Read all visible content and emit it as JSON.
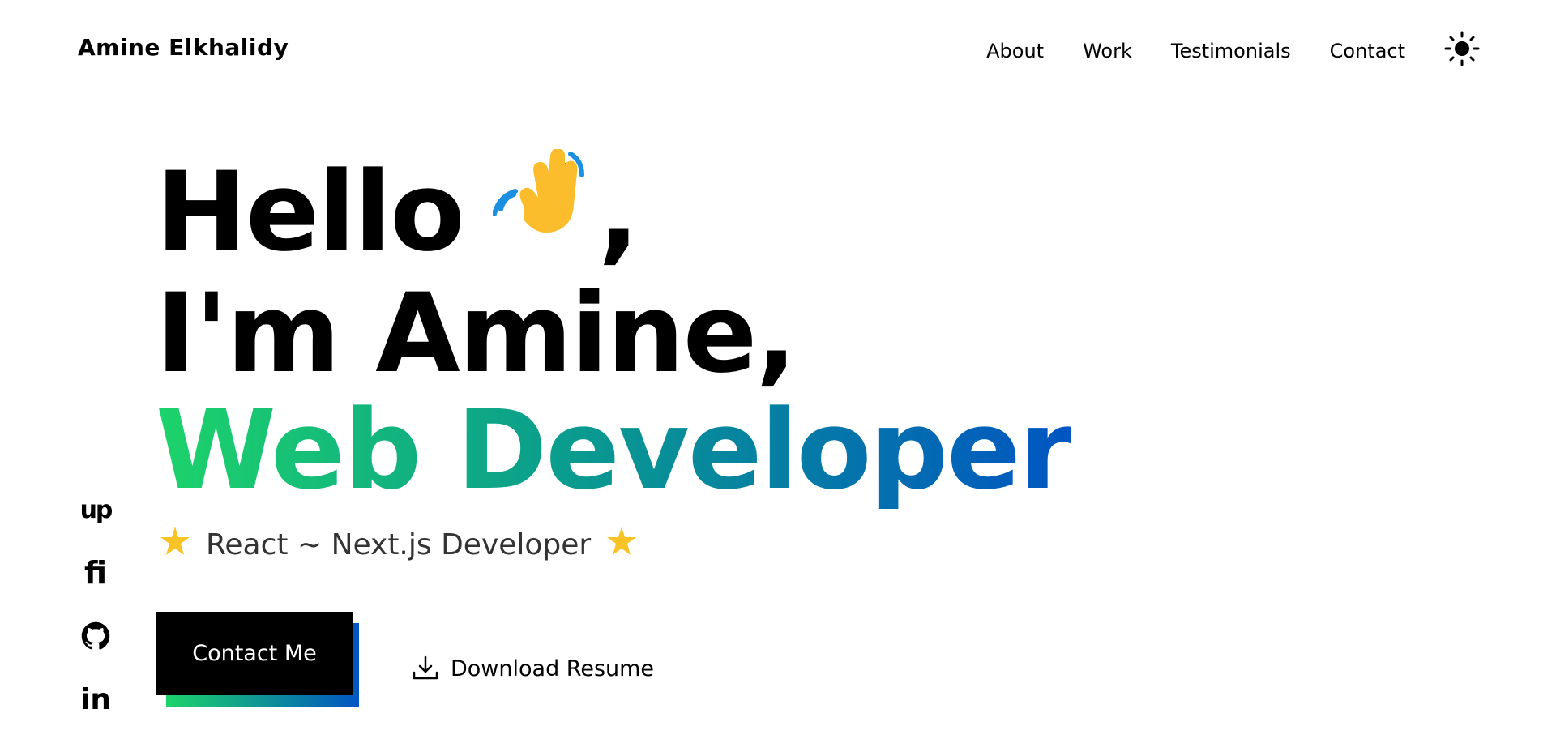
{
  "header": {
    "brand": "Amine Elkhalidy",
    "nav": [
      "About",
      "Work",
      "Testimonials",
      "Contact"
    ],
    "theme_icon": "sun-icon"
  },
  "hero": {
    "line1": "Hello",
    "line1_suffix": ",",
    "line2": "I'm Amine,",
    "line3": "Web Developer",
    "wave_icon": "waving-hand-icon",
    "subtitle": "React ~ Next.js Developer",
    "subtitle_icon": "glowing-star-icon"
  },
  "actions": {
    "contact": "Contact Me",
    "download": "Download Resume",
    "download_icon": "download-icon"
  },
  "socials": {
    "upwork_text": "up",
    "fiverr_text": "fi",
    "linkedin_text": "in",
    "icons": [
      "upwork-icon",
      "fiverr-icon",
      "github-icon",
      "linkedin-icon"
    ]
  },
  "colors": {
    "gradient_start": "#1dd36a",
    "gradient_mid": "#0a9c8e",
    "gradient_end": "#0055c2",
    "text": "#000000",
    "background": "#ffffff"
  }
}
